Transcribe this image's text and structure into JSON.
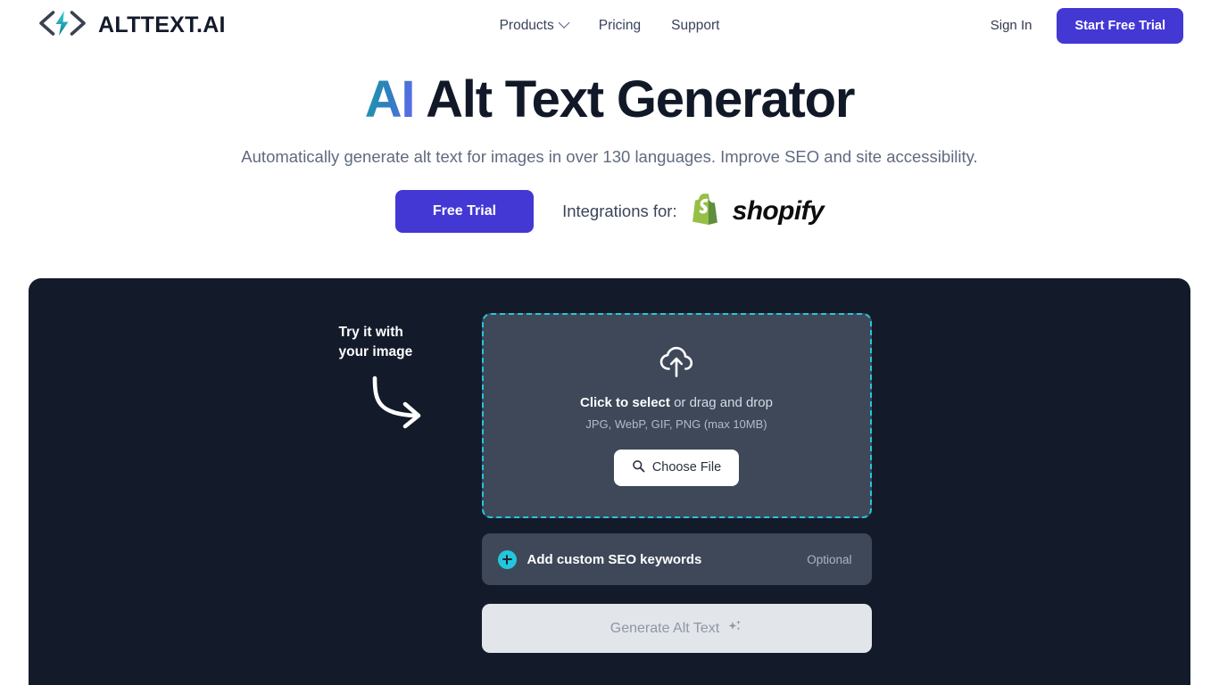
{
  "header": {
    "brand_name": "ALTTEXT.AI",
    "brand_icon": "code-brackets-lightning-logo",
    "nav": [
      {
        "label": "Products",
        "icon": "chevron-down-icon",
        "has_chevron": true
      },
      {
        "label": "Pricing",
        "has_chevron": false
      },
      {
        "label": "Support",
        "has_chevron": false
      }
    ],
    "sign_in": "Sign In",
    "start_free_trial": "Start Free Trial"
  },
  "hero": {
    "title_accent": "AI",
    "title_rest": "Alt Text Generator",
    "subtitle": "Automatically generate alt text for images in over 130 languages. Improve SEO and site accessibility.",
    "free_trial_button": "Free Trial",
    "integrations_label": "Integrations for:",
    "integration_brand": "shopify",
    "integration_icon": "shopify-bag-icon"
  },
  "panel": {
    "try_it_line1": "Try it with",
    "try_it_line2": "your image",
    "arrow_icon": "curved-arrow-right-icon",
    "dropzone": {
      "icon": "cloud-upload-icon",
      "title_bold": "Click to select",
      "title_rest": " or drag and drop",
      "formats": "JPG, WebP, GIF, PNG (max 10MB)",
      "choose_file_label": "Choose File",
      "choose_file_icon": "search-icon"
    },
    "keywords": {
      "icon": "plus-circle-icon",
      "label": "Add custom SEO keywords",
      "optional": "Optional"
    },
    "generate": {
      "label": "Generate Alt Text",
      "icon": "sparkles-icon",
      "disabled": true
    }
  },
  "colors": {
    "brand_purple": "#4338d4",
    "accent_cyan": "#22c7dd",
    "panel_dark": "#131a2a",
    "dropzone_fill": "#3e4858",
    "text_dark": "#111827",
    "text_muted": "#5f6b80"
  }
}
